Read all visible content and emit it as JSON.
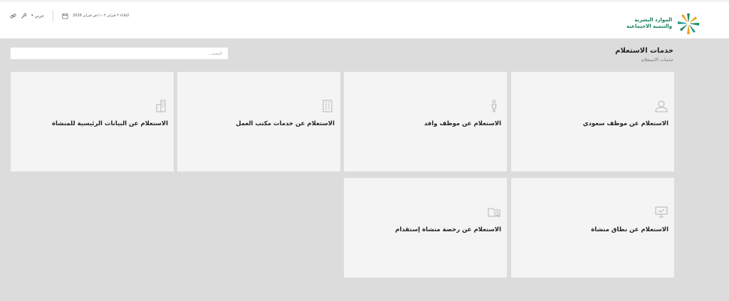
{
  "header": {
    "logo": {
      "line1": "الموارد البشرية",
      "line2": "والتنمية الاجتماعية"
    },
    "date": "الثلاثاء ٣ فبراير ١١:٠٣ص فبراير 2026",
    "language": "عربي"
  },
  "page": {
    "title": "خدمات الاستعلام",
    "breadcrumb": "خدمات الاستعلام"
  },
  "search": {
    "placeholder": "البحث...",
    "value": ""
  },
  "cards": [
    {
      "label": "الاستعلام عن موظف سعودي",
      "icon": "user-icon"
    },
    {
      "label": "الاستعلام عن موظف وافد",
      "icon": "person-icon"
    },
    {
      "label": "الاستعلام عن خدمات مكتب العمل",
      "icon": "building-icon"
    },
    {
      "label": "الاستعلام عن البيانات الرئيسية للمنشاة",
      "icon": "buildings-icon"
    },
    {
      "label": "الاستعلام عن نطاق منشاة",
      "icon": "presentation-board-icon"
    },
    {
      "label": "الاستعلام عن رخصة منشاة إستقدام",
      "icon": "folder-search-icon"
    }
  ],
  "colors": {
    "background": "#dcdcdc",
    "card": "#f4f4f4",
    "brand_green": "#0f7a59",
    "icon_gray": "#b3b3b3"
  }
}
